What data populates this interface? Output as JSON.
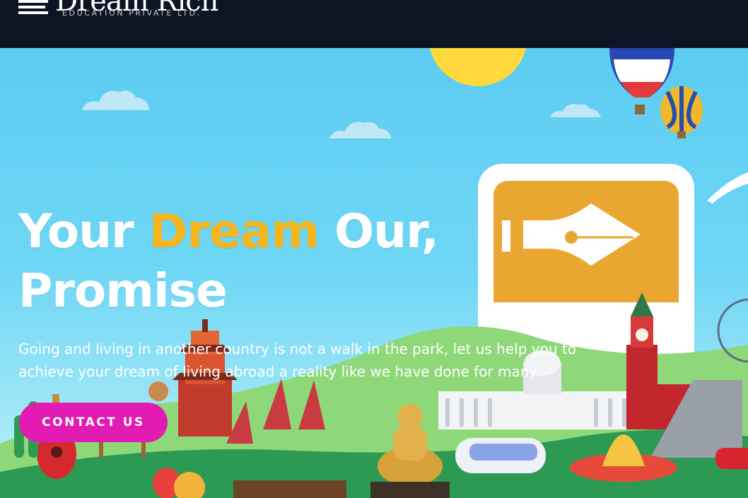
{
  "brand": {
    "name": "Dream Rich",
    "tagline": "EDUCATION PRIVATE LTD."
  },
  "hero": {
    "headline_before": "Your ",
    "headline_highlight": "Dream",
    "headline_after_1": " Our,",
    "headline_line2": "Promise",
    "intro": "Going and living in another country is not a walk in the park, let us help you to achieve your dream of living abroad a reality like we have done for many.",
    "cta_label": "CONTACT US"
  },
  "colors": {
    "topbar_bg": "#0d1423",
    "sky": "#5ccbf2",
    "highlight": "#f6b51d",
    "cta": "#e21bb3",
    "text": "#ffffff"
  },
  "icons": [
    "logo-mark-icon",
    "fountain-pen-icon",
    "hot-air-balloon-icon",
    "sun-icon",
    "cloud-icon"
  ]
}
